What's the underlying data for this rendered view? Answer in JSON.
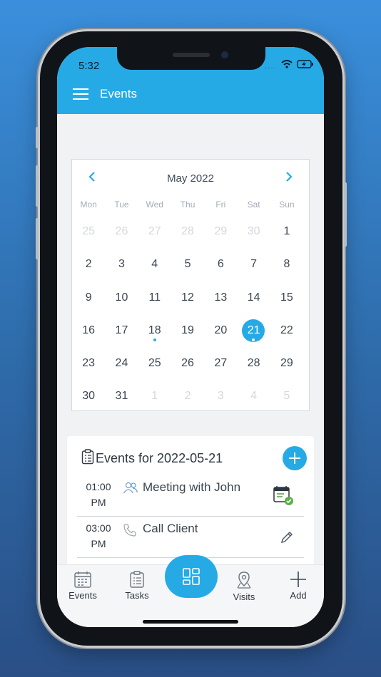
{
  "status": {
    "time": "5:32",
    "signal": "....",
    "wifi": "wifi-icon",
    "battery": "battery-charging-icon"
  },
  "header": {
    "title": "Events",
    "menu_icon": "hamburger-menu-icon"
  },
  "calendar": {
    "month_label": "May 2022",
    "prev_icon": "chevron-left-icon",
    "next_icon": "chevron-right-icon",
    "weekdays": [
      "Mon",
      "Tue",
      "Wed",
      "Thu",
      "Fri",
      "Sat",
      "Sun"
    ],
    "weeks": [
      [
        "25",
        "26",
        "27",
        "28",
        "29",
        "30",
        "1"
      ],
      [
        "2",
        "3",
        "4",
        "5",
        "6",
        "7",
        "8"
      ],
      [
        "9",
        "10",
        "11",
        "12",
        "13",
        "14",
        "15"
      ],
      [
        "16",
        "17",
        "18",
        "19",
        "20",
        "21",
        "22"
      ],
      [
        "23",
        "24",
        "25",
        "26",
        "27",
        "28",
        "29"
      ],
      [
        "30",
        "31",
        "1",
        "2",
        "3",
        "4",
        "5"
      ]
    ],
    "muted_days": [
      "w0d0",
      "w0d1",
      "w0d2",
      "w0d3",
      "w0d4",
      "w0d5",
      "w5d2",
      "w5d3",
      "w5d4",
      "w5d5",
      "w5d6"
    ],
    "selected_day": "21",
    "days_with_events": [
      "18",
      "21"
    ],
    "accent_color": "#26aae6"
  },
  "events": {
    "title": "Events for 2022-05-21",
    "add_icon": "plus-icon",
    "items": [
      {
        "time": "01:00",
        "ampm": "PM",
        "name": "Meeting with John",
        "type_icon": "people-icon",
        "action_icon": "calendar-check-icon"
      },
      {
        "time": "03:00",
        "ampm": "PM",
        "name": "Call Client",
        "type_icon": "phone-icon",
        "action_icon": "pencil-icon"
      }
    ]
  },
  "tabbar": {
    "tabs": [
      {
        "label": "Events",
        "icon": "calendar-icon"
      },
      {
        "label": "Tasks",
        "icon": "clipboard-icon"
      },
      {
        "label": "Visits",
        "icon": "map-pin-icon"
      },
      {
        "label": "Add",
        "icon": "plus-icon"
      }
    ],
    "center_icon": "grid-icon"
  }
}
